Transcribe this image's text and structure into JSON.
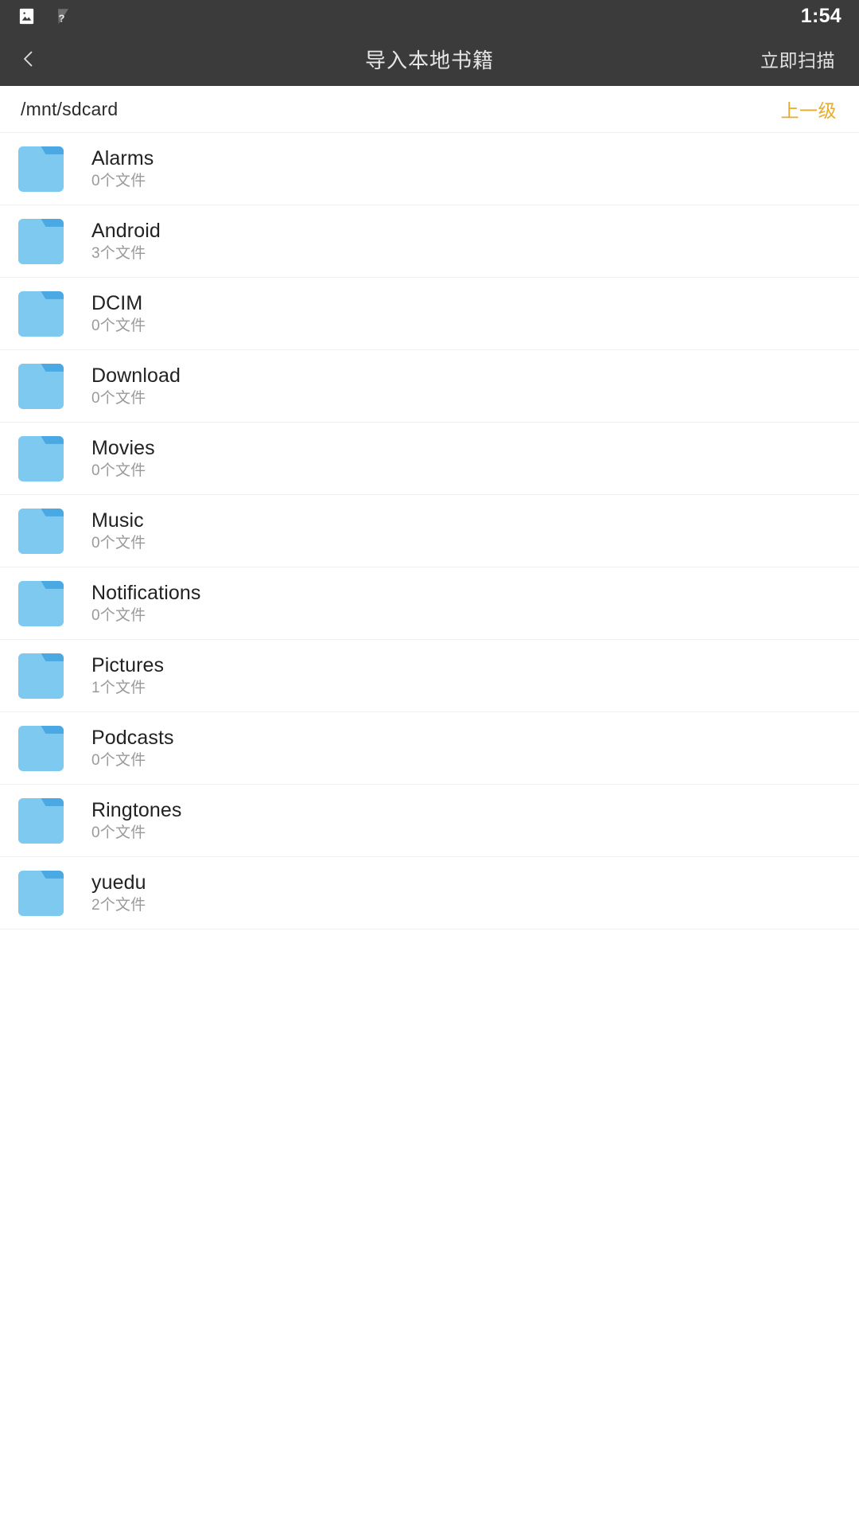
{
  "status_bar": {
    "icons": [
      "photo-icon",
      "wifi-unknown-icon"
    ],
    "time": "1:54",
    "background_color": "#3b3b3b"
  },
  "app_bar": {
    "back_icon": "chevron-left-icon",
    "title": "导入本地书籍",
    "action_label": "立即扫描",
    "background_color": "#3b3b3b"
  },
  "path_bar": {
    "current_path": "/mnt/sdcard",
    "up_label": "上一级",
    "up_color": "#e5ab33"
  },
  "file_list": {
    "folder_icon": "folder-icon",
    "folder_color": "#7ec9ef",
    "folder_tab_color": "#4aa8e3",
    "items": [
      {
        "name": "Alarms",
        "meta": "0个文件"
      },
      {
        "name": "Android",
        "meta": "3个文件"
      },
      {
        "name": "DCIM",
        "meta": "0个文件"
      },
      {
        "name": "Download",
        "meta": "0个文件"
      },
      {
        "name": "Movies",
        "meta": "0个文件"
      },
      {
        "name": "Music",
        "meta": "0个文件"
      },
      {
        "name": "Notifications",
        "meta": "0个文件"
      },
      {
        "name": "Pictures",
        "meta": "1个文件"
      },
      {
        "name": "Podcasts",
        "meta": "0个文件"
      },
      {
        "name": "Ringtones",
        "meta": "0个文件"
      },
      {
        "name": "yuedu",
        "meta": "2个文件"
      }
    ]
  }
}
